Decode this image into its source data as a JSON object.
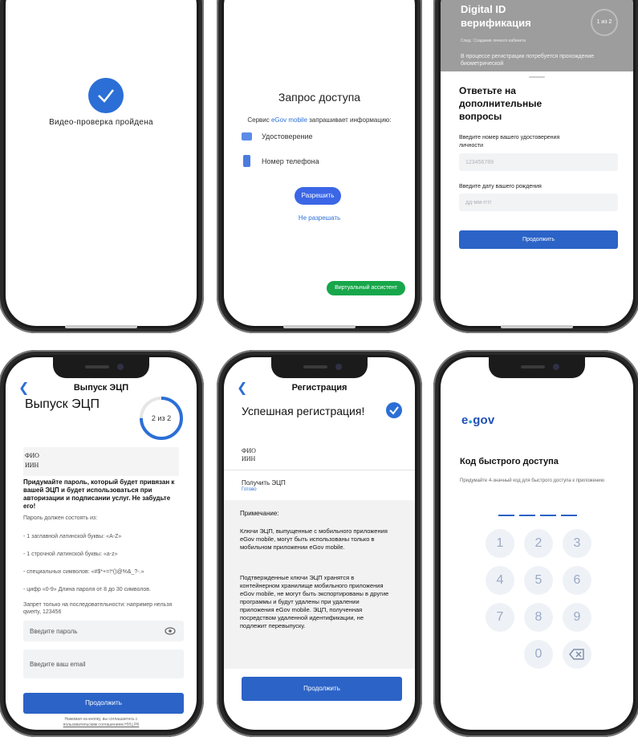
{
  "s1": {
    "status": "Видео-проверка пройдена"
  },
  "s2": {
    "title": "Запрос доступа",
    "service_prefix": "Сервис ",
    "service_name": "eGov mobile",
    "service_suffix": " запрашивает информацию:",
    "items": [
      {
        "icon": "id-card-icon",
        "label": "Удостоверение"
      },
      {
        "icon": "phone-icon",
        "label": "Номер телефона"
      }
    ],
    "allow": "Разрешить",
    "deny": "Не разрешать",
    "assistant": "Виртуальный ассистент"
  },
  "s3": {
    "header_title": "Digital ID\nверификация",
    "step": "1 из 2",
    "next_step": "След.: Создание личного кабинета",
    "note": "В процессе регистрации потребуется прохождение биометрической",
    "sheet_title": "Ответьте на дополнительные вопросы",
    "id_label": "Введите номер вашего удостоверения личности",
    "id_placeholder": "123456789",
    "dob_label": "Введите дату вашего рождения",
    "dob_placeholder": "дд-мм-гггг",
    "continue": "Продолжить"
  },
  "s4": {
    "header": "Выпуск ЭЦП",
    "title": "Выпуск ЭЦП",
    "step": "2 из 2",
    "progress": 0.75,
    "fio": "ФИО",
    "iin": "ИИН",
    "instructions": "Придумайте пароль, который будет привязан к вашей ЭЦП и будет использоваться при авторизации и подписании услуг. Не забудьте его!",
    "rules_title": "Пароль должен состоять из:",
    "rules": [
      "- 1 заглавной латинской буквы: «A-Z»",
      "- 1 строчной латинской буквы: «a-z»",
      "- специальных символов: «#$*+=!*()@%&_?-.»",
      "- цифр «0-9» Длина пароля от 8 до 30 символов."
    ],
    "forbidden": "Запрет только на последовательности: например нельзя qwerty, 123456",
    "password_placeholder": "Введите пароль",
    "email_placeholder": "Введите ваш email",
    "continue": "Продолжить",
    "agreement_prefix": "Нажимая на кнопку, вы соглашаетесь с",
    "agreement_link": "пользовательским соглашением НУЦ РК"
  },
  "s5": {
    "header": "Регистрация",
    "title": "Успешная регистрация!",
    "fio": "ФИО",
    "iin": "ИИН",
    "get_ecp": "Получить ЭЦП",
    "done": "Готово",
    "note_title": "Примечание:",
    "note_p1": "Ключи ЭЦП, выпущенные с мобильного приложения eGov mobile, могут быть использованы только в мобильном приложении eGov mobile.",
    "note_p2": "Подтвержденные ключи ЭЦП хранятся в контейнерном хранилище мобильного приложения eGov mobile, не могут быть экспортированы в другие программы и будут удалены при удалении приложения eGov mobile. ЭЦП, полученная посредством удаленной идентификации, не подлежит перевыпуску.",
    "continue": "Продолжить"
  },
  "s6": {
    "logo_prefix": "e",
    "logo_suffix": "gov",
    "title": "Код быстрого доступа",
    "subtitle": "Придумайте 4-значный код для быстрого доступа к приложению",
    "keys": [
      "1",
      "2",
      "3",
      "4",
      "5",
      "6",
      "7",
      "8",
      "9",
      "0"
    ],
    "colors": {
      "accent": "#2b63c7",
      "key_bg": "#eef2f7"
    }
  },
  "colors": {
    "primary": "#2b63c7",
    "link": "#2b6fd6",
    "assistant": "#17a74a"
  }
}
